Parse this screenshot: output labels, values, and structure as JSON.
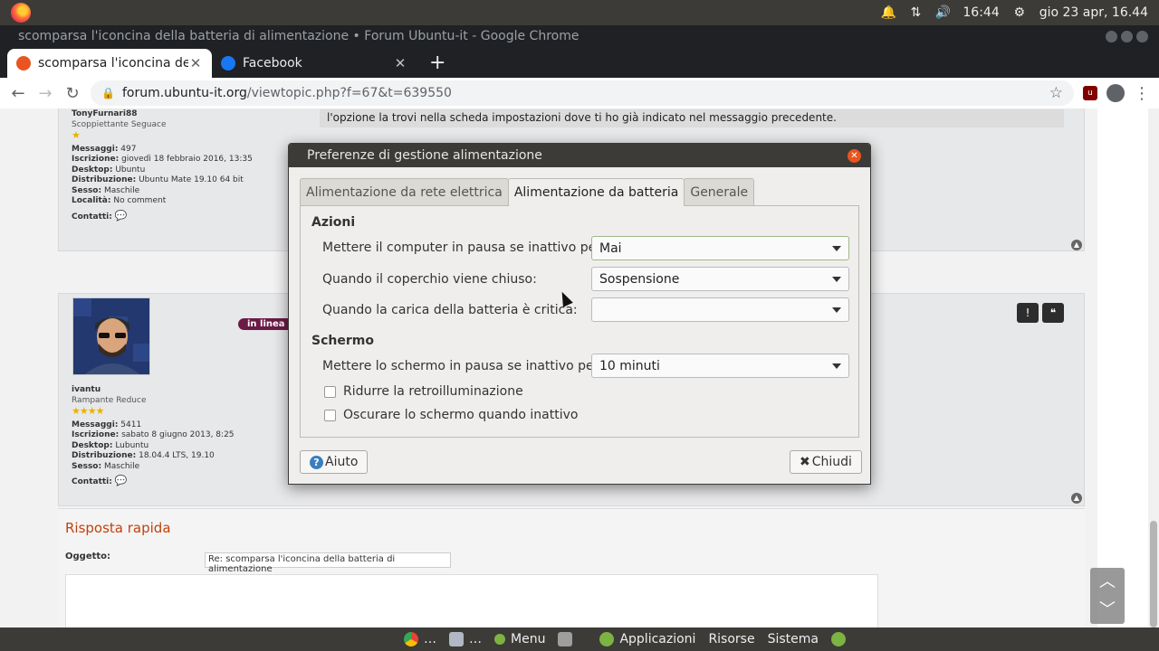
{
  "top_panel": {
    "time": "16:44",
    "date": "gio 23 apr, 16.44"
  },
  "chrome": {
    "window_title": "scomparsa l'iconcina della batteria di alimentazione • Forum Ubuntu-it - Google Chrome",
    "tabs": [
      {
        "title": "scomparsa l'iconcina della",
        "active": true
      },
      {
        "title": "Facebook",
        "active": false
      }
    ],
    "url_domain": "forum.ubuntu-it.org",
    "url_path": "/viewtopic.php?f=67&t=639550"
  },
  "forum": {
    "post1": {
      "username": "TonyFurnari88",
      "rank": "Scoppiettante Seguace",
      "messages_label": "Messaggi:",
      "messages": "497",
      "registered_label": "Iscrizione:",
      "registered": "giovedì 18 febbraio 2016, 13:35",
      "desktop_label": "Desktop:",
      "desktop": "Ubuntu",
      "distro_label": "Distribuzione:",
      "distro": "Ubuntu Mate 19.10 64 bit",
      "sex_label": "Sesso:",
      "sex": "Maschile",
      "location_label": "Località:",
      "location": "No comment",
      "contacts_label": "Contatti:",
      "quote_text": "l'opzione la trovi nella scheda impostazioni dove ti ho già indicato nel messaggio precedente."
    },
    "post2": {
      "online_badge": "in linea",
      "username": "ivantu",
      "rank": "Rampante Reduce",
      "messages_label": "Messaggi:",
      "messages": "5411",
      "registered_label": "Iscrizione:",
      "registered": "sabato 8 giugno 2013, 8:25",
      "desktop_label": "Desktop:",
      "desktop": "Lubuntu",
      "distro_label": "Distribuzione:",
      "distro": "18.04.4 LTS, 19.10",
      "sex_label": "Sesso:",
      "sex": "Maschile",
      "contacts_label": "Contatti:"
    },
    "quick_reply": {
      "title": "Risposta rapida",
      "subject_label": "Oggetto:",
      "subject_value": "Re: scomparsa l'iconcina della batteria di alimentazione"
    }
  },
  "dialog": {
    "title": "Preferenze di gestione alimentazione",
    "tabs": [
      "Alimentazione da rete elettrica",
      "Alimentazione da batteria",
      "Generale"
    ],
    "section_actions": "Azioni",
    "row1_label": "Mettere il computer in pausa se inattivo per:",
    "row1_value": "Mai",
    "row2_label": "Quando il coperchio viene chiuso:",
    "row2_value": "Sospensione",
    "row3_label": "Quando la carica della batteria è critica:",
    "row3_value": "",
    "section_screen": "Schermo",
    "row4_label": "Mettere lo schermo in pausa se inattivo per:",
    "row4_value": "10 minuti",
    "check1": "Ridurre la retroilluminazione",
    "check2": "Oscurare lo schermo quando inattivo",
    "help_button": "Aiuto",
    "close_button": "Chiudi"
  },
  "bottom_panel": {
    "ellipsis1": "…",
    "ellipsis2": "…",
    "menu": "Menu",
    "apps": "Applicazioni",
    "resources": "Risorse",
    "system": "Sistema"
  }
}
